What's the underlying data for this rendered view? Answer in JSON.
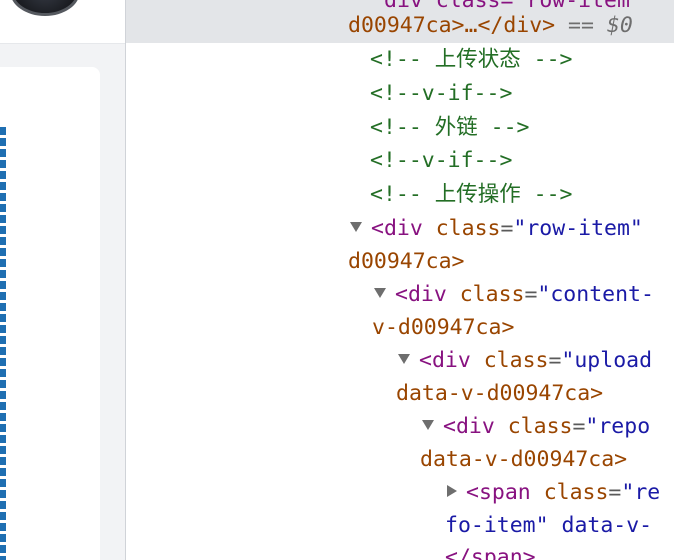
{
  "selected": {
    "top_fragment": "div class=\"row-item\"",
    "line2": "d00947ca>…</div>",
    "suffix": " == $0"
  },
  "lines": [
    {
      "text": "<!-- 上传状态 -->"
    },
    {
      "text": "<!--v-if-->"
    },
    {
      "text": "<!-- 外链 -->"
    },
    {
      "text": "<!--v-if-->"
    },
    {
      "text": "<!-- 上传操作 -->"
    }
  ],
  "nodes": [
    {
      "open": "<div",
      "attr": "class",
      "value": "\"row-item\"",
      "wrap": "d00947ca>"
    },
    {
      "open": "<div",
      "attr": "class",
      "value": "\"content-",
      "wrap": "v-d00947ca>"
    },
    {
      "open": "<div",
      "attr": "class",
      "value": "\"upload",
      "wrap": "data-v-d00947ca>"
    },
    {
      "open": "<div",
      "attr": "class",
      "value": "\"repo",
      "wrap": "data-v-d00947ca>"
    },
    {
      "open": "<span",
      "attr": "class",
      "value": "\"re",
      "wrap": "fo-item\" data-v-",
      "close": "</span>"
    }
  ]
}
